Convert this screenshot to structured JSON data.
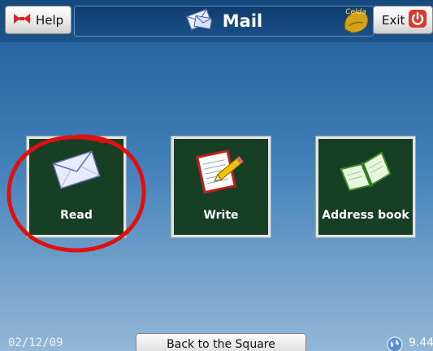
{
  "header": {
    "help_label": "Help",
    "title": "Mail",
    "brand_logo_text": "Celda",
    "exit_label": "Exit"
  },
  "tiles": [
    {
      "label": "Read",
      "icon": "envelope-icon",
      "highlighted": true
    },
    {
      "label": "Write",
      "icon": "notepad-pencil-icon"
    },
    {
      "label": "Address book",
      "icon": "address-book-icon"
    }
  ],
  "footer": {
    "date": "02/12/09",
    "back_label": "Back to the Square",
    "version": "9.44"
  },
  "colors": {
    "background_top": "#1f5c9a",
    "background_bottom": "#93b7d6",
    "tile_bg": "#163f24",
    "highlight_circle": "#e01010",
    "exit_icon": "#d93a2b"
  }
}
